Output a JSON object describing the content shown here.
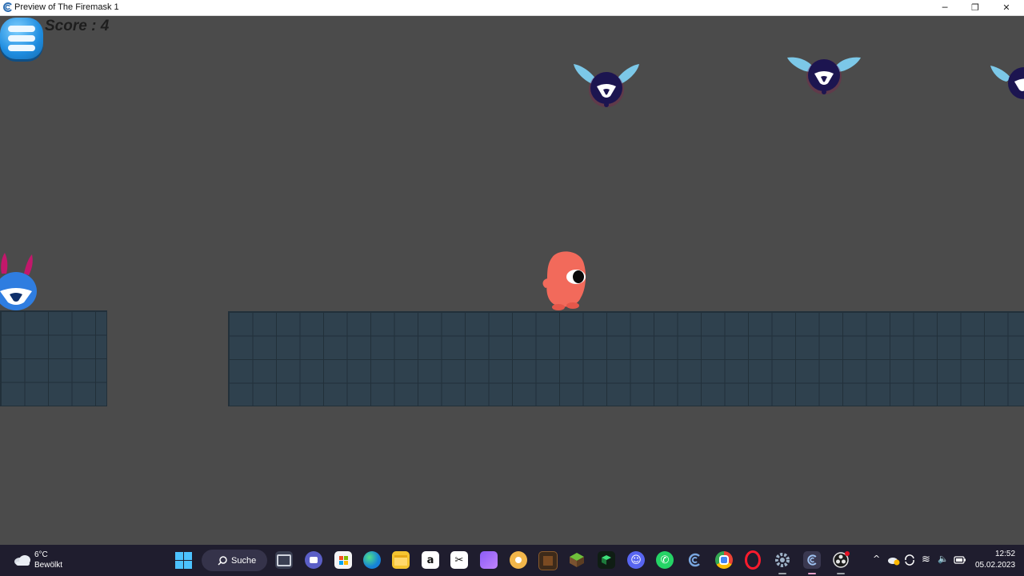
{
  "window": {
    "title": "Preview of The Firemask 1",
    "minimize": "─",
    "restore": "❐",
    "close": "✕"
  },
  "hud": {
    "score_label": "Score : 4",
    "menu_icon": "hamburger-menu-icon"
  },
  "taskbar": {
    "weather": {
      "temp": "6°C",
      "desc": "Bewölkt",
      "icon": "cloud-icon"
    },
    "search_label": "Suche",
    "clock": {
      "time": "12:52",
      "date": "05.02.2023"
    },
    "apps": [
      "start-icon",
      "task-view-icon",
      "teams-chat-icon",
      "store-icon",
      "edge-icon",
      "file-explorer-icon",
      "amazon-icon",
      "capcut-icon",
      "clipchamp-icon",
      "app-icon",
      "minecraft-launcher-icon",
      "minecraft-icon",
      "minecraft-dungeons-icon",
      "discord-icon",
      "whatsapp-icon",
      "gdevelop-icon",
      "chrome-icon",
      "opera-icon",
      "settings-icon",
      "gdevelop-preview-icon",
      "obs-icon"
    ],
    "amazon_glyph": "a",
    "capcut_glyph": "✂",
    "discord_glyph": "☺",
    "whatsapp_glyph": "✆"
  },
  "tray": {
    "chevron": "^",
    "wifi": "≋",
    "volume": "🔈"
  },
  "colors": {
    "background": "#4b4b4b",
    "platform": "#2f414e",
    "player": "#f26a5b",
    "flyer": "#1c1550",
    "wing": "#7cc8e8",
    "blue_monster": "#2f7de0"
  }
}
